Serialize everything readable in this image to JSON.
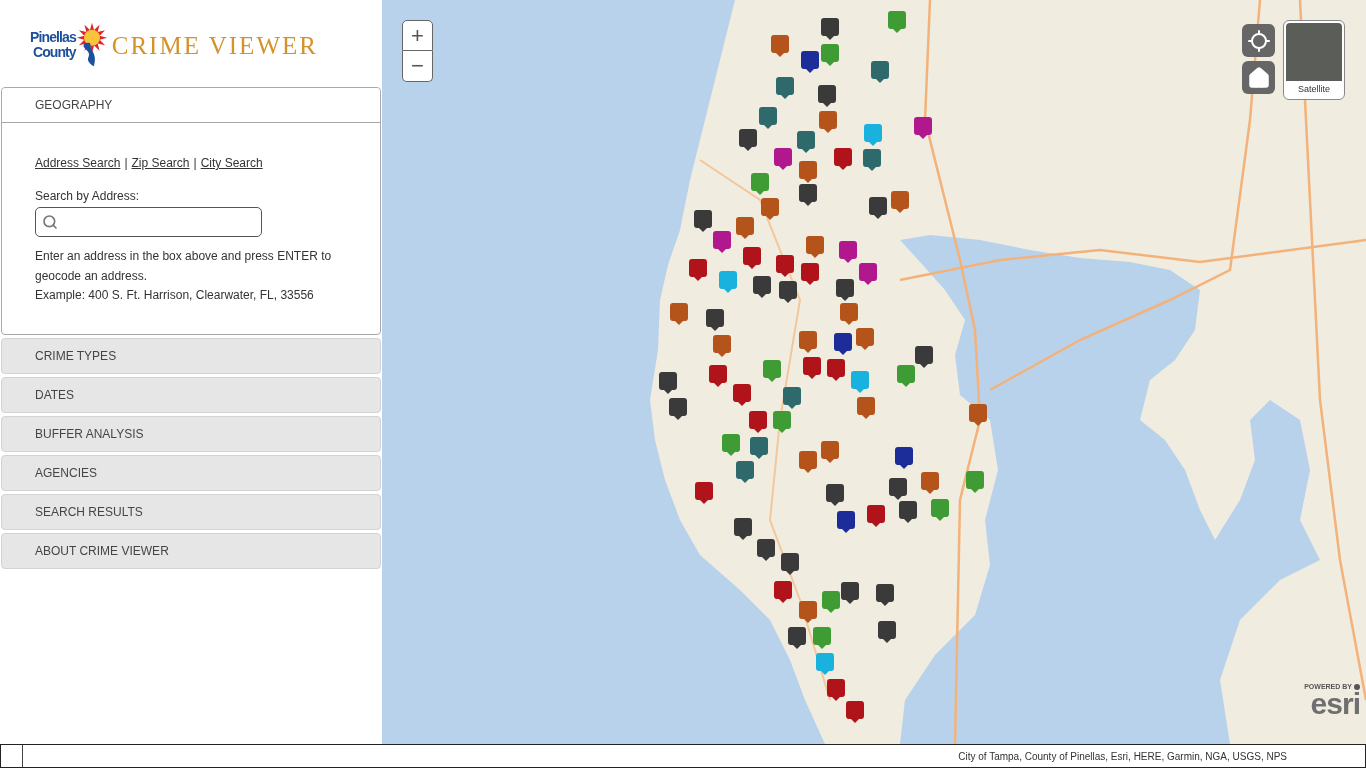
{
  "logo": {
    "county_line_1": "Pinellas",
    "county_line_2": "County",
    "title": "CRIME VIEWER"
  },
  "sidebar": {
    "sections": [
      {
        "label": "GEOGRAPHY",
        "expanded": true,
        "content": {
          "search_modes": [
            {
              "kind": "link",
              "text": "Address Search"
            },
            {
              "kind": "separator",
              "text": "|"
            },
            {
              "kind": "link",
              "text": "Zip Search"
            },
            {
              "kind": "separator",
              "text": "|"
            },
            {
              "kind": "link",
              "text": "City Search"
            }
          ],
          "field_label": "Search by Address:",
          "help": [
            "Enter an address in the box above and press ENTER to geocode an address.",
            "Example: 400 S. Ft. Harrison, Clearwater, FL, 33556"
          ]
        }
      },
      {
        "label": "CRIME TYPES",
        "expanded": false
      },
      {
        "label": "DATES",
        "expanded": false
      },
      {
        "label": "BUFFER ANALYSIS",
        "expanded": false
      },
      {
        "label": "AGENCIES",
        "expanded": false
      },
      {
        "label": "SEARCH RESULTS",
        "expanded": false
      },
      {
        "label": "ABOUT CRIME VIEWER",
        "expanded": false
      }
    ]
  },
  "map": {
    "zoom_in": "+",
    "zoom_out": "−",
    "basemap_toggle": {
      "label": "Satellite"
    },
    "markers": [
      {
        "color": "#3a3a3a"
      },
      {
        "color": "#3f9b34"
      },
      {
        "color": "#b4531a"
      },
      {
        "color": "#1c2c98"
      },
      {
        "color": "#3f9b34"
      },
      {
        "color": "#2e6a6b"
      },
      {
        "color": "#2e6a6b"
      },
      {
        "color": "#3a3a3a"
      },
      {
        "color": "#2e6a6b"
      },
      {
        "color": "#3a3a3a"
      },
      {
        "color": "#b4531a"
      },
      {
        "color": "#19b1de"
      },
      {
        "color": "#b1188d"
      },
      {
        "color": "#2e6a6b"
      },
      {
        "color": "#b1188d"
      },
      {
        "color": "#b01319"
      },
      {
        "color": "#2e6a6b"
      },
      {
        "color": "#3f9b34"
      },
      {
        "color": "#b4531a"
      },
      {
        "color": "#3a3a3a"
      },
      {
        "color": "#b4531a"
      },
      {
        "color": "#3a3a3a"
      },
      {
        "color": "#b4531a"
      },
      {
        "color": "#3a3a3a"
      },
      {
        "color": "#b4531a"
      },
      {
        "color": "#b1188d"
      },
      {
        "color": "#b01319"
      },
      {
        "color": "#b01319"
      },
      {
        "color": "#b4531a"
      },
      {
        "color": "#b1188d"
      },
      {
        "color": "#b01319"
      },
      {
        "color": "#19b1de"
      },
      {
        "color": "#b01319"
      },
      {
        "color": "#b1188d"
      },
      {
        "color": "#3a3a3a"
      },
      {
        "color": "#3a3a3a"
      },
      {
        "color": "#3a3a3a"
      },
      {
        "color": "#b4531a"
      },
      {
        "color": "#3a3a3a"
      },
      {
        "color": "#b4531a"
      },
      {
        "color": "#b4531a"
      },
      {
        "color": "#b4531a"
      },
      {
        "color": "#b4531a"
      },
      {
        "color": "#1c2c98"
      },
      {
        "color": "#3a3a3a"
      },
      {
        "color": "#b01319"
      },
      {
        "color": "#3f9b34"
      },
      {
        "color": "#b01319"
      },
      {
        "color": "#3a3a3a"
      },
      {
        "color": "#b01319"
      },
      {
        "color": "#2e6a6b"
      },
      {
        "color": "#b01319"
      },
      {
        "color": "#19b1de"
      },
      {
        "color": "#3f9b34"
      },
      {
        "color": "#3a3a3a"
      },
      {
        "color": "#b01319"
      },
      {
        "color": "#3f9b34"
      },
      {
        "color": "#b4531a"
      },
      {
        "color": "#b4531a"
      },
      {
        "color": "#3f9b34"
      },
      {
        "color": "#2e6a6b"
      },
      {
        "color": "#2e6a6b"
      },
      {
        "color": "#b4531a"
      },
      {
        "color": "#b4531a"
      },
      {
        "color": "#1c2c98"
      },
      {
        "color": "#b01319"
      },
      {
        "color": "#3a3a3a"
      },
      {
        "color": "#3a3a3a"
      },
      {
        "color": "#b4531a"
      },
      {
        "color": "#3f9b34"
      },
      {
        "color": "#3f9b34"
      },
      {
        "color": "#1c2c98"
      },
      {
        "color": "#b01319"
      },
      {
        "color": "#3a3a3a"
      },
      {
        "color": "#3a3a3a"
      },
      {
        "color": "#3a3a3a"
      },
      {
        "color": "#3a3a3a"
      },
      {
        "color": "#b01319"
      },
      {
        "color": "#3a3a3a"
      },
      {
        "color": "#3a3a3a"
      },
      {
        "color": "#b4531a"
      },
      {
        "color": "#3f9b34"
      },
      {
        "color": "#3f9b34"
      },
      {
        "color": "#3a3a3a"
      },
      {
        "color": "#3a3a3a"
      },
      {
        "color": "#19b1de"
      },
      {
        "color": "#b01319"
      },
      {
        "color": "#b01319"
      }
    ]
  },
  "status_bar": {
    "attribution": "City of Tampa, County of Pinellas, Esri, HERE, Garmin, NGA, USGS, NPS",
    "esri_logo": {
      "tagline": "POWERED BY",
      "name": "esri"
    }
  }
}
